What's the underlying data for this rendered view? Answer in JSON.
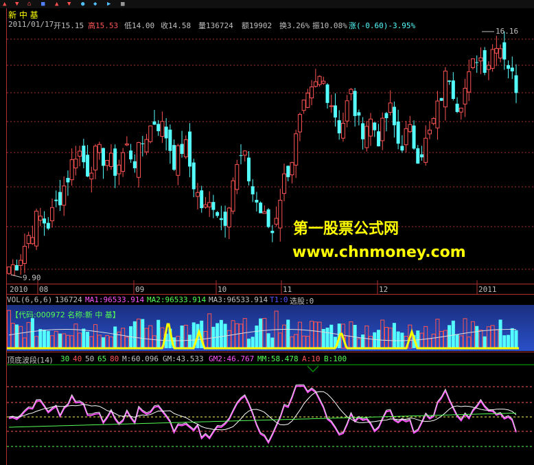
{
  "stock": {
    "name": "新 中 基"
  },
  "header": {
    "date": "2011/01/17",
    "open": "开15.15",
    "high": "高15.53",
    "low": "低14.00",
    "close": "收14.58",
    "volume": "量136724",
    "amount": "额19902",
    "turnover": "换3.26%",
    "amplitude": "振10.08%",
    "change": "涨(-0.60)-3.95%"
  },
  "time_axis": [
    "2010",
    "08",
    "09",
    "10",
    "11",
    "12",
    "2011"
  ],
  "vol_bar": {
    "label": "VOL(6,6,6)",
    "value": "136724",
    "ma1": "MA1:96533.914",
    "ma2": "MA2:96533.914",
    "ma3": "MA3:96533.914",
    "t": "T1:0",
    "select": "选股:0"
  },
  "vol_panel_tag": "【代码:000972 名称:新 中 基】",
  "osc_bar": {
    "label": "顶底波段(14)",
    "levels": [
      "30",
      "40",
      "50",
      "65",
      "80"
    ],
    "m": "M:60.096",
    "gm": "GM:43.533",
    "gm2": "GM2:46.767",
    "mm": "MM:58.478",
    "a": "A:10",
    "b": "B:100"
  },
  "watermark": {
    "line1": "第一股票公式网",
    "line2": "www.chnmoney.com"
  },
  "colors": {
    "up": "#ff5454",
    "down": "#54ffff",
    "grid": "#b0302e",
    "yellow": "#ffff00",
    "magenta": "#ff54ff",
    "green": "#54ff54"
  },
  "chart_data": {
    "type": "candlestick",
    "price_high_label": "16.16",
    "price_low_label": "9.90",
    "price_range": [
      9.9,
      16.16
    ],
    "close_approx": [
      10.0,
      10.3,
      10.9,
      11.4,
      11.2,
      11.8,
      12.4,
      13.2,
      12.6,
      13.0,
      12.9,
      12.6,
      13.2,
      12.8,
      13.5,
      13.9,
      13.6,
      12.8,
      13.3,
      12.2,
      11.5,
      11.8,
      11.2,
      12.4,
      13.0,
      12.0,
      11.4,
      11.0,
      12.2,
      12.9,
      14.0,
      14.5,
      15.0,
      14.4,
      13.6,
      14.6,
      13.6,
      13.9,
      13.4,
      14.2,
      13.2,
      13.6,
      13.0,
      13.4,
      14.2,
      15.2,
      14.3,
      14.8,
      15.6,
      15.3,
      16.0,
      15.5,
      14.6
    ]
  }
}
